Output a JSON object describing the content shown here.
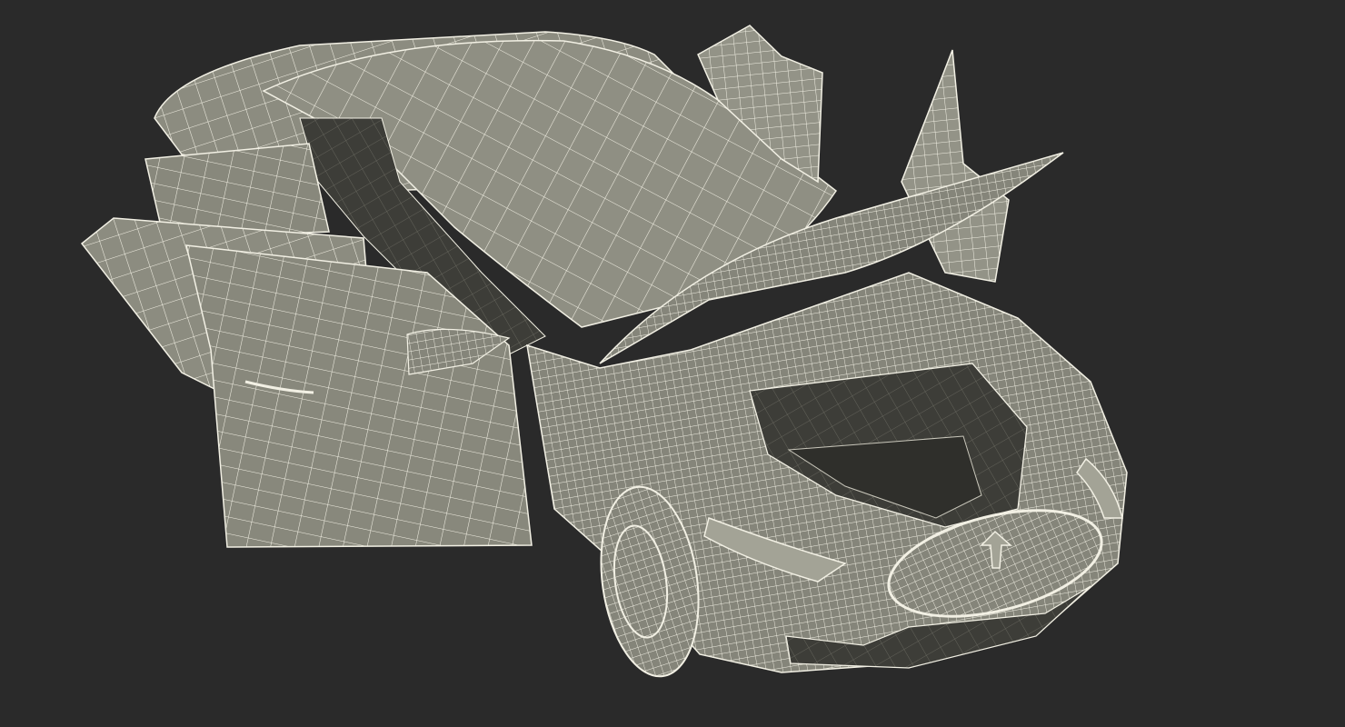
{
  "scene": {
    "subject": "car-wireframe-model",
    "colors": {
      "background": "#2a2a2a",
      "surface": "#8c8c80",
      "surface_light": "#a3a396",
      "surface_dark": "#6f6f65",
      "interior": "#3a3a36",
      "wire": "#f2f0e4"
    }
  }
}
